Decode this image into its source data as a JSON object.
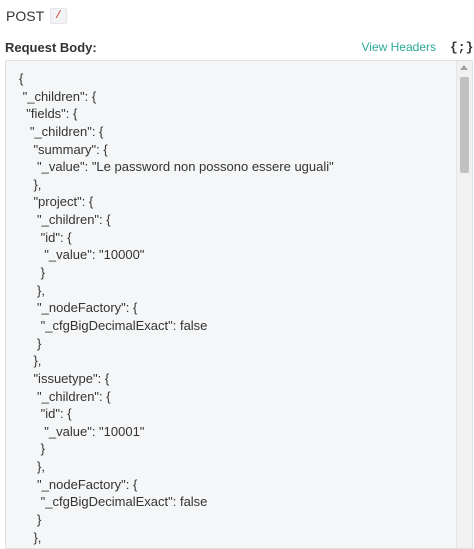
{
  "request": {
    "method": "POST",
    "path": "/"
  },
  "section": {
    "title": "Request Body:",
    "view_headers": "View Headers",
    "format_icon": "{;}"
  },
  "code_lines": [
    "{",
    " \"_children\": {",
    "  \"fields\": {",
    "   \"_children\": {",
    "    \"summary\": {",
    "     \"_value\": \"Le password non possono essere uguali\"",
    "    },",
    "    \"project\": {",
    "     \"_children\": {",
    "      \"id\": {",
    "       \"_value\": \"10000\"",
    "      }",
    "     },",
    "     \"_nodeFactory\": {",
    "      \"_cfgBigDecimalExact\": false",
    "     }",
    "    },",
    "    \"issuetype\": {",
    "     \"_children\": {",
    "      \"id\": {",
    "       \"_value\": \"10001\"",
    "      }",
    "     },",
    "     \"_nodeFactory\": {",
    "      \"_cfgBigDecimalExact\": false",
    "     }",
    "    },"
  ]
}
